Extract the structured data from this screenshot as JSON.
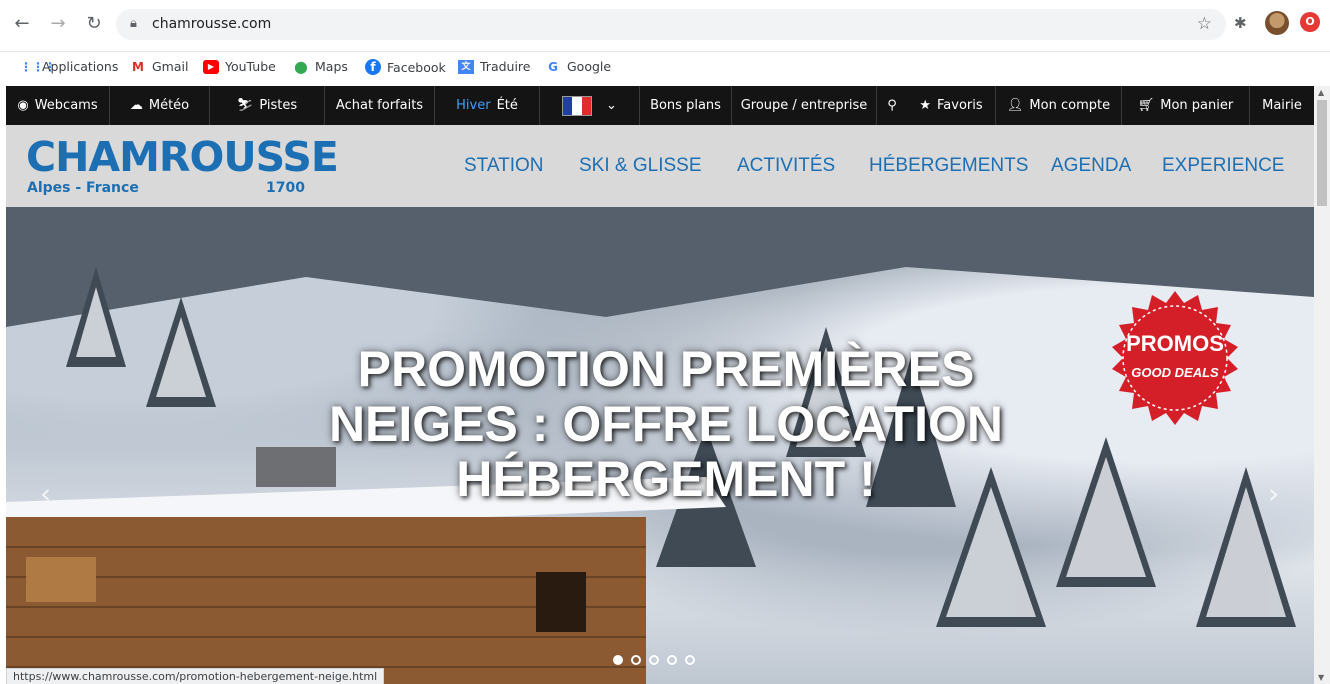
{
  "browser": {
    "url": "chamrousse.com",
    "status_url": "https://www.chamrousse.com/promotion-hebergement-neige.html"
  },
  "bookmarks": [
    {
      "label": "Applications",
      "icon": "apps-grid-icon"
    },
    {
      "label": "Gmail",
      "icon": "gmail-icon"
    },
    {
      "label": "YouTube",
      "icon": "youtube-icon"
    },
    {
      "label": "Maps",
      "icon": "maps-pin-icon"
    },
    {
      "label": "Facebook",
      "icon": "facebook-icon"
    },
    {
      "label": "Traduire",
      "icon": "translate-icon"
    },
    {
      "label": "Google",
      "icon": "google-icon"
    }
  ],
  "topbar": {
    "webcams": "Webcams",
    "meteo": "Météo",
    "pistes": "Pistes",
    "achat_forfaits": "Achat forfaits",
    "season_winter": "Hiver",
    "season_summer": "Été",
    "bons_plans": "Bons plans",
    "groupe": "Groupe / entreprise",
    "favoris": "Favoris",
    "mon_compte": "Mon compte",
    "mon_panier": "Mon panier",
    "mairie": "Mairie"
  },
  "header": {
    "logo_main": "CHAMROUSSE",
    "logo_sub1": "Alpes - France",
    "logo_sub2": "1700",
    "nav": [
      "STATION",
      "SKI & GLISSE",
      "ACTIVITÉS",
      "HÉBERGEMENTS",
      "AGENDA",
      "EXPERIENCE"
    ]
  },
  "hero": {
    "title": "PROMOTION PREMIÈRES NEIGES : OFFRE LOCATION HÉBERGEMENT !",
    "badge_line1": "PROMOS",
    "badge_line2": "GOOD DEALS",
    "slides_total": 5,
    "active_slide": 1
  },
  "colors": {
    "brand_blue": "#1d6fb3",
    "topbar_bg": "#141414",
    "header_bg": "#d9d9d9",
    "promo_red": "#d51f28"
  }
}
